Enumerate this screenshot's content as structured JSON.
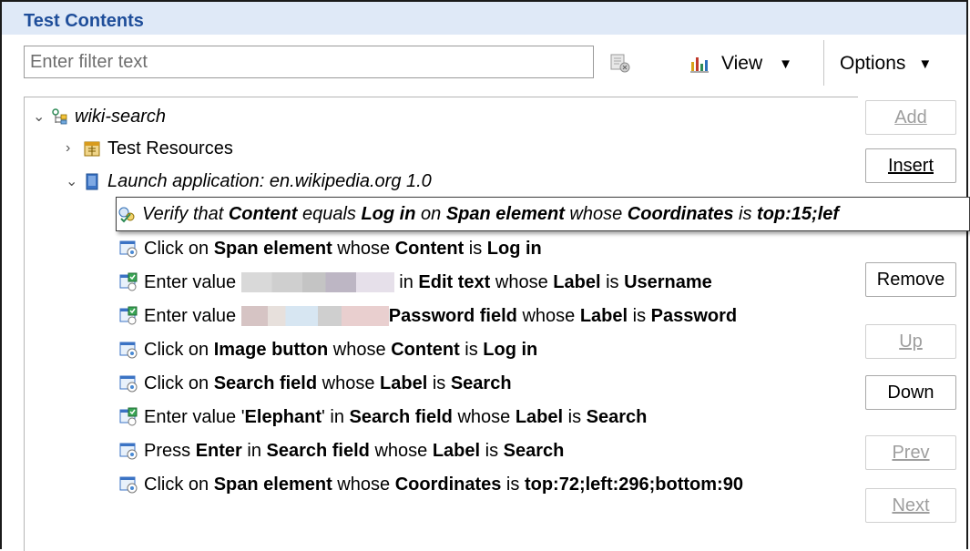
{
  "panel": {
    "title": "Test Contents"
  },
  "toolbar": {
    "filter_placeholder": "Enter filter text",
    "view_label": "View",
    "options_label": "Options"
  },
  "tree": {
    "root": {
      "label": "wiki-search"
    },
    "resources": {
      "label": "Test Resources"
    },
    "launch": {
      "label": "Launch application: en.wikipedia.org  1.0"
    },
    "steps": [
      {
        "icon": "verify-step-icon",
        "parts": [
          {
            "t": "Verify that ",
            "b": false
          },
          {
            "t": "Content",
            "b": true
          },
          {
            "t": " equals ",
            "b": false
          },
          {
            "t": "Log in",
            "b": true
          },
          {
            "t": " on ",
            "b": false
          },
          {
            "t": "Span element",
            "b": true
          },
          {
            "t": " whose ",
            "b": false
          },
          {
            "t": "Coordinates",
            "b": true
          },
          {
            "t": " is ",
            "b": false
          },
          {
            "t": "top:15;lef",
            "b": true
          }
        ]
      },
      {
        "icon": "click-step-icon",
        "parts": [
          {
            "t": "Click on ",
            "b": false
          },
          {
            "t": "Span element",
            "b": true
          },
          {
            "t": " whose ",
            "b": false
          },
          {
            "t": "Content",
            "b": true
          },
          {
            "t": " is ",
            "b": false
          },
          {
            "t": "Log in",
            "b": true
          }
        ]
      },
      {
        "icon": "enter-value-step-icon",
        "parts": [
          {
            "t": "Enter value ",
            "b": false
          },
          {
            "t": "__MASK1__",
            "b": false
          },
          {
            "t": " in ",
            "b": false
          },
          {
            "t": "Edit text",
            "b": true
          },
          {
            "t": " whose ",
            "b": false
          },
          {
            "t": "Label",
            "b": true
          },
          {
            "t": " is ",
            "b": false
          },
          {
            "t": "Username",
            "b": true
          }
        ]
      },
      {
        "icon": "enter-value-step-icon",
        "parts": [
          {
            "t": "Enter value ",
            "b": false
          },
          {
            "t": "__MASK2__",
            "b": false
          },
          {
            "t": "Password field",
            "b": true
          },
          {
            "t": " whose ",
            "b": false
          },
          {
            "t": "Label",
            "b": true
          },
          {
            "t": " is ",
            "b": false
          },
          {
            "t": "Password",
            "b": true
          }
        ]
      },
      {
        "icon": "click-step-icon",
        "parts": [
          {
            "t": "Click on ",
            "b": false
          },
          {
            "t": "Image button",
            "b": true
          },
          {
            "t": " whose ",
            "b": false
          },
          {
            "t": "Content",
            "b": true
          },
          {
            "t": " is ",
            "b": false
          },
          {
            "t": "Log in",
            "b": true
          }
        ]
      },
      {
        "icon": "click-step-icon",
        "parts": [
          {
            "t": "Click on ",
            "b": false
          },
          {
            "t": "Search field",
            "b": true
          },
          {
            "t": " whose ",
            "b": false
          },
          {
            "t": "Label",
            "b": true
          },
          {
            "t": " is ",
            "b": false
          },
          {
            "t": "Search",
            "b": true
          }
        ]
      },
      {
        "icon": "enter-value-step-icon",
        "parts": [
          {
            "t": "Enter value '",
            "b": false
          },
          {
            "t": "Elephant",
            "b": true
          },
          {
            "t": "' in ",
            "b": false
          },
          {
            "t": "Search field",
            "b": true
          },
          {
            "t": " whose ",
            "b": false
          },
          {
            "t": "Label",
            "b": true
          },
          {
            "t": " is ",
            "b": false
          },
          {
            "t": "Search",
            "b": true
          }
        ]
      },
      {
        "icon": "click-step-icon",
        "parts": [
          {
            "t": "Press ",
            "b": false
          },
          {
            "t": "Enter",
            "b": true
          },
          {
            "t": " in ",
            "b": false
          },
          {
            "t": "Search field",
            "b": true
          },
          {
            "t": " whose ",
            "b": false
          },
          {
            "t": "Label",
            "b": true
          },
          {
            "t": " is ",
            "b": false
          },
          {
            "t": "Search",
            "b": true
          }
        ]
      },
      {
        "icon": "click-step-icon",
        "parts": [
          {
            "t": "Click on ",
            "b": false
          },
          {
            "t": "Span element",
            "b": true
          },
          {
            "t": " whose ",
            "b": false
          },
          {
            "t": "Coordinates",
            "b": true
          },
          {
            "t": " is ",
            "b": false
          },
          {
            "t": "top:72;left:296;bottom:90",
            "b": true
          }
        ]
      }
    ]
  },
  "buttons": {
    "add": "Add",
    "insert": "Insert",
    "remove": "Remove",
    "up": "Up",
    "down": "Down",
    "prev": "Prev",
    "next": "Next"
  },
  "colors": {
    "title_bar_bg": "#dfe9f7",
    "title_text": "#1f4e9a",
    "disabled_text": "#9e9e9e"
  }
}
